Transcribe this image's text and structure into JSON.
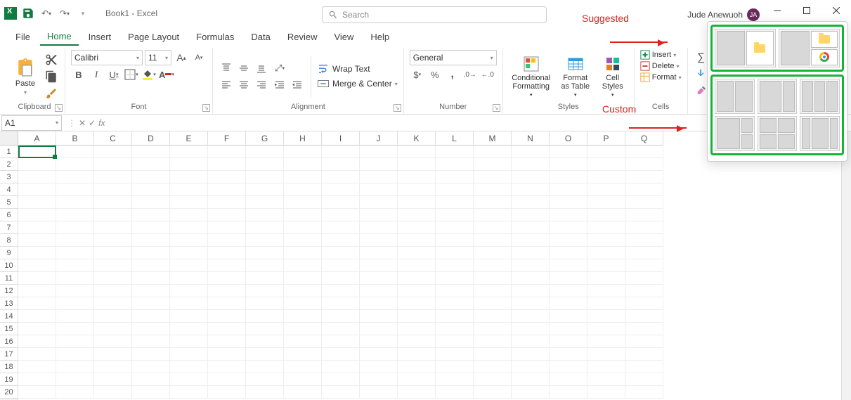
{
  "title": "Book1 - Excel",
  "search_placeholder": "Search",
  "user_name": "Jude Anewuoh",
  "user_initials": "JA",
  "annotations": {
    "suggested": "Suggested",
    "custom": "Custom"
  },
  "tabs": [
    "File",
    "Home",
    "Insert",
    "Page Layout",
    "Formulas",
    "Data",
    "Review",
    "View",
    "Help"
  ],
  "active_tab": "Home",
  "ribbon": {
    "clipboard": {
      "label": "Clipboard",
      "paste": "Paste"
    },
    "font": {
      "label": "Font",
      "name": "Calibri",
      "size": "11"
    },
    "alignment": {
      "label": "Alignment",
      "wrap": "Wrap Text",
      "merge": "Merge & Center"
    },
    "number": {
      "label": "Number",
      "format": "General"
    },
    "styles": {
      "label": "Styles",
      "conditional": "Conditional Formatting",
      "table": "Format as Table",
      "cell": "Cell Styles"
    },
    "cells": {
      "label": "Cells",
      "insert": "Insert",
      "delete": "Delete",
      "format": "Format"
    }
  },
  "namebox": "A1",
  "columns": [
    "A",
    "B",
    "C",
    "D",
    "E",
    "F",
    "G",
    "H",
    "I",
    "J",
    "K",
    "L",
    "M",
    "N",
    "O",
    "P",
    "Q"
  ],
  "rows": [
    "1",
    "2",
    "3",
    "4",
    "5",
    "6",
    "7",
    "8",
    "9",
    "10",
    "11",
    "12",
    "13",
    "14",
    "15",
    "16",
    "17",
    "18",
    "19",
    "20"
  ]
}
